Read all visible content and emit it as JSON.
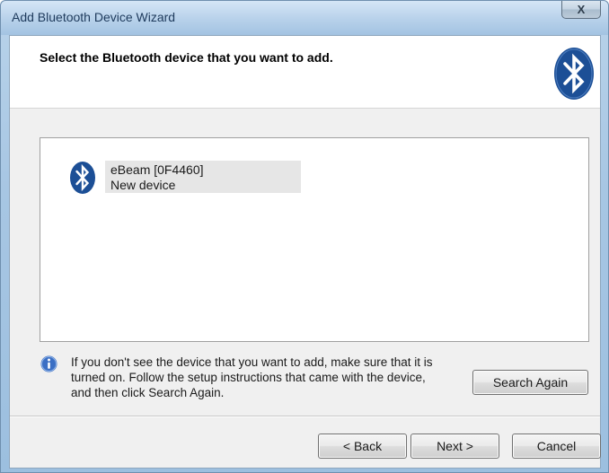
{
  "window": {
    "title": "Add Bluetooth Device Wizard",
    "close_label": "X"
  },
  "header": {
    "title": "Select the Bluetooth device that you want to add.",
    "logo_icon": "bluetooth-icon"
  },
  "device_list": {
    "items": [
      {
        "name": "eBeam [0F4460]",
        "status": "New device",
        "icon": "bluetooth-icon"
      }
    ]
  },
  "info": {
    "icon": "info-icon",
    "lines": [
      "If you don't see the device that you want to add, make sure that it is",
      "turned on. Follow the setup instructions that came with the device,",
      "and then click Search Again."
    ]
  },
  "buttons": {
    "search_again": "Search Again",
    "back": "< Back",
    "next": "Next >",
    "cancel": "Cancel"
  },
  "colors": {
    "bluetooth_blue": "#1c4f96",
    "info_blue": "#3b6fc4",
    "title_text": "#1e3a5c"
  }
}
